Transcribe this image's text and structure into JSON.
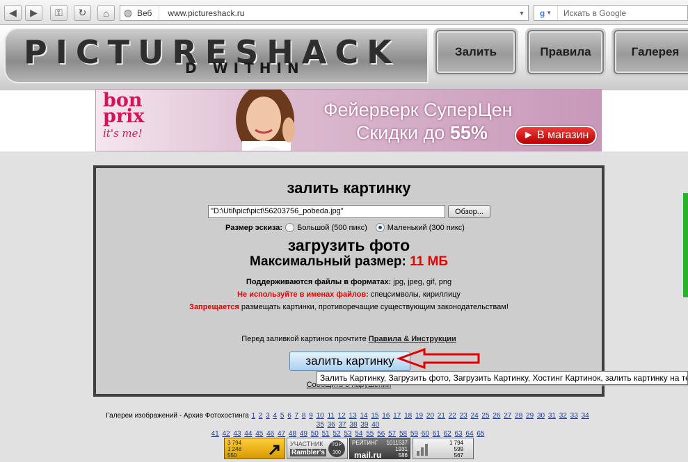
{
  "browser": {
    "address_engine": "Веб",
    "url": "www.pictureshack.ru",
    "search_placeholder": "Искать в Google",
    "search_logo": "g"
  },
  "header": {
    "logo_text": "PICTURESHACK",
    "logo_sub": "D WITHIN",
    "menu": [
      "Залить",
      "Правила",
      "Галерея"
    ]
  },
  "banner": {
    "brand_line1": "bon",
    "brand_line2": "prix",
    "brand_slogan": "it's me!",
    "line1": "Фейерверк СуперЦен",
    "line2_prefix": "Скидки до ",
    "line2_value": "55%",
    "button": "► В магазин"
  },
  "upload": {
    "heading": "залить картинку",
    "file_value": "\"D:\\Util\\pict\\pict\\56203756_pobeda.jpg\"",
    "browse_label": "Обзор...",
    "size_label": "Размер эскиза:",
    "option_large": "Большой (500 пикс)",
    "option_small": "Маленький (300 пикс)",
    "selected_option": "small",
    "photo_heading": "загрузить фото",
    "max_label": "Максимальный размер: ",
    "max_value": "11 МБ",
    "formats_label": "Поддерживаются файлы в форматах:",
    "formats_value": " jpg, jpeg, gif, png",
    "names_label": "Не используйте в именах файлов:",
    "names_value": " спецсимволы, кириллицу",
    "forbidden_label": "Запрещается",
    "forbidden_value": " размещать картинки, противоречащие существующим законодательствам!",
    "before_text": "Перед заливкой картинок прочтите ",
    "rules_link": "Правила & Инструкции",
    "upload_button": "залить картинку",
    "report_link": "Сообщить о нарушении",
    "tooltip": "Залить Картинку, Загрузить фото, Загрузить Картинку, Хостинг Картинок, залить картинку на тел"
  },
  "gallery": {
    "label": "Галереи изображений - Архив Фотохостинга",
    "pages_row1": [
      "1",
      "2",
      "3",
      "4",
      "5",
      "6",
      "7",
      "8",
      "9",
      "10",
      "11",
      "12",
      "13",
      "14",
      "15",
      "16",
      "17",
      "18",
      "19",
      "20",
      "21",
      "22",
      "23",
      "24",
      "25",
      "26",
      "27",
      "28",
      "29",
      "30",
      "31",
      "32",
      "33",
      "34",
      "35",
      "36",
      "37",
      "38",
      "39",
      "40"
    ],
    "pages_row2": [
      "41",
      "42",
      "43",
      "44",
      "45",
      "46",
      "47",
      "48",
      "49",
      "50",
      "51",
      "52",
      "53",
      "54",
      "55",
      "56",
      "57",
      "58",
      "59",
      "60",
      "61",
      "62",
      "63",
      "64",
      "65"
    ]
  },
  "counters": {
    "c1": [
      "3 794",
      "1 248",
      "550"
    ],
    "c2_title": "УЧАСТНИК",
    "c2_brand": "Rambler's",
    "c2_badge": "TOP 100",
    "c3_title": "РЕЙТИНГ",
    "c3_values": [
      "1011537",
      "1931",
      "586"
    ],
    "c3_brand": "mail.ru",
    "c4": [
      "1 794",
      "599",
      "567"
    ]
  }
}
